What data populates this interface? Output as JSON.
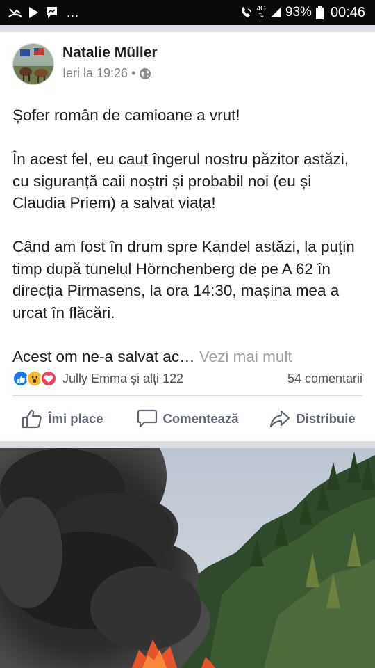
{
  "status_bar": {
    "notif_icons": [
      "missed-call-icon",
      "play-store-icon",
      "messenger-icon"
    ],
    "more": "...",
    "network": "4G",
    "battery": "93%",
    "time": "00:46"
  },
  "post": {
    "author": "Natalie Müller",
    "time": "Ieri la 19:26",
    "privacy_icon": "globe-icon",
    "paragraphs": [
      "Șofer român de camioane a vrut!",
      "În acest fel, eu caut îngerul nostru păzitor astăzi, cu siguranță caii noștri și probabil noi (eu și Claudia Priem) a salvat viața!",
      "Când am fost în drum spre Kandel astăzi, la puțin timp după tunelul Hörnchenberg de pe A 62 în direcția Pirmasens, la ora 14:30, mașina mea a urcat în flăcări."
    ],
    "truncated_text": "Acest om ne-a salvat ac…",
    "see_more": "Vezi mai mult",
    "reactions": {
      "icons": [
        "like-icon",
        "wow-icon",
        "love-icon"
      ],
      "names": "Jully Emma și alți 122"
    },
    "comments": "54 comentarii",
    "actions": {
      "like": "Îmi place",
      "comment": "Comentează",
      "share": "Distribuie"
    }
  },
  "colors": {
    "accent": "#1877f2",
    "muted": "#606770",
    "divider": "#dadde1"
  }
}
